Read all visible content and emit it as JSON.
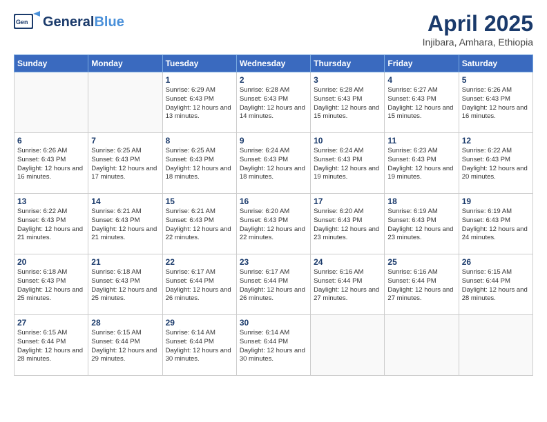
{
  "header": {
    "logo_general": "General",
    "logo_blue": "Blue",
    "month_title": "April 2025",
    "location": "Injibara, Amhara, Ethiopia"
  },
  "days_of_week": [
    "Sunday",
    "Monday",
    "Tuesday",
    "Wednesday",
    "Thursday",
    "Friday",
    "Saturday"
  ],
  "weeks": [
    [
      {
        "day": "",
        "info": ""
      },
      {
        "day": "",
        "info": ""
      },
      {
        "day": "1",
        "info": "Sunrise: 6:29 AM\nSunset: 6:43 PM\nDaylight: 12 hours and 13 minutes."
      },
      {
        "day": "2",
        "info": "Sunrise: 6:28 AM\nSunset: 6:43 PM\nDaylight: 12 hours and 14 minutes."
      },
      {
        "day": "3",
        "info": "Sunrise: 6:28 AM\nSunset: 6:43 PM\nDaylight: 12 hours and 15 minutes."
      },
      {
        "day": "4",
        "info": "Sunrise: 6:27 AM\nSunset: 6:43 PM\nDaylight: 12 hours and 15 minutes."
      },
      {
        "day": "5",
        "info": "Sunrise: 6:26 AM\nSunset: 6:43 PM\nDaylight: 12 hours and 16 minutes."
      }
    ],
    [
      {
        "day": "6",
        "info": "Sunrise: 6:26 AM\nSunset: 6:43 PM\nDaylight: 12 hours and 16 minutes."
      },
      {
        "day": "7",
        "info": "Sunrise: 6:25 AM\nSunset: 6:43 PM\nDaylight: 12 hours and 17 minutes."
      },
      {
        "day": "8",
        "info": "Sunrise: 6:25 AM\nSunset: 6:43 PM\nDaylight: 12 hours and 18 minutes."
      },
      {
        "day": "9",
        "info": "Sunrise: 6:24 AM\nSunset: 6:43 PM\nDaylight: 12 hours and 18 minutes."
      },
      {
        "day": "10",
        "info": "Sunrise: 6:24 AM\nSunset: 6:43 PM\nDaylight: 12 hours and 19 minutes."
      },
      {
        "day": "11",
        "info": "Sunrise: 6:23 AM\nSunset: 6:43 PM\nDaylight: 12 hours and 19 minutes."
      },
      {
        "day": "12",
        "info": "Sunrise: 6:22 AM\nSunset: 6:43 PM\nDaylight: 12 hours and 20 minutes."
      }
    ],
    [
      {
        "day": "13",
        "info": "Sunrise: 6:22 AM\nSunset: 6:43 PM\nDaylight: 12 hours and 21 minutes."
      },
      {
        "day": "14",
        "info": "Sunrise: 6:21 AM\nSunset: 6:43 PM\nDaylight: 12 hours and 21 minutes."
      },
      {
        "day": "15",
        "info": "Sunrise: 6:21 AM\nSunset: 6:43 PM\nDaylight: 12 hours and 22 minutes."
      },
      {
        "day": "16",
        "info": "Sunrise: 6:20 AM\nSunset: 6:43 PM\nDaylight: 12 hours and 22 minutes."
      },
      {
        "day": "17",
        "info": "Sunrise: 6:20 AM\nSunset: 6:43 PM\nDaylight: 12 hours and 23 minutes."
      },
      {
        "day": "18",
        "info": "Sunrise: 6:19 AM\nSunset: 6:43 PM\nDaylight: 12 hours and 23 minutes."
      },
      {
        "day": "19",
        "info": "Sunrise: 6:19 AM\nSunset: 6:43 PM\nDaylight: 12 hours and 24 minutes."
      }
    ],
    [
      {
        "day": "20",
        "info": "Sunrise: 6:18 AM\nSunset: 6:43 PM\nDaylight: 12 hours and 25 minutes."
      },
      {
        "day": "21",
        "info": "Sunrise: 6:18 AM\nSunset: 6:43 PM\nDaylight: 12 hours and 25 minutes."
      },
      {
        "day": "22",
        "info": "Sunrise: 6:17 AM\nSunset: 6:44 PM\nDaylight: 12 hours and 26 minutes."
      },
      {
        "day": "23",
        "info": "Sunrise: 6:17 AM\nSunset: 6:44 PM\nDaylight: 12 hours and 26 minutes."
      },
      {
        "day": "24",
        "info": "Sunrise: 6:16 AM\nSunset: 6:44 PM\nDaylight: 12 hours and 27 minutes."
      },
      {
        "day": "25",
        "info": "Sunrise: 6:16 AM\nSunset: 6:44 PM\nDaylight: 12 hours and 27 minutes."
      },
      {
        "day": "26",
        "info": "Sunrise: 6:15 AM\nSunset: 6:44 PM\nDaylight: 12 hours and 28 minutes."
      }
    ],
    [
      {
        "day": "27",
        "info": "Sunrise: 6:15 AM\nSunset: 6:44 PM\nDaylight: 12 hours and 28 minutes."
      },
      {
        "day": "28",
        "info": "Sunrise: 6:15 AM\nSunset: 6:44 PM\nDaylight: 12 hours and 29 minutes."
      },
      {
        "day": "29",
        "info": "Sunrise: 6:14 AM\nSunset: 6:44 PM\nDaylight: 12 hours and 30 minutes."
      },
      {
        "day": "30",
        "info": "Sunrise: 6:14 AM\nSunset: 6:44 PM\nDaylight: 12 hours and 30 minutes."
      },
      {
        "day": "",
        "info": ""
      },
      {
        "day": "",
        "info": ""
      },
      {
        "day": "",
        "info": ""
      }
    ]
  ]
}
